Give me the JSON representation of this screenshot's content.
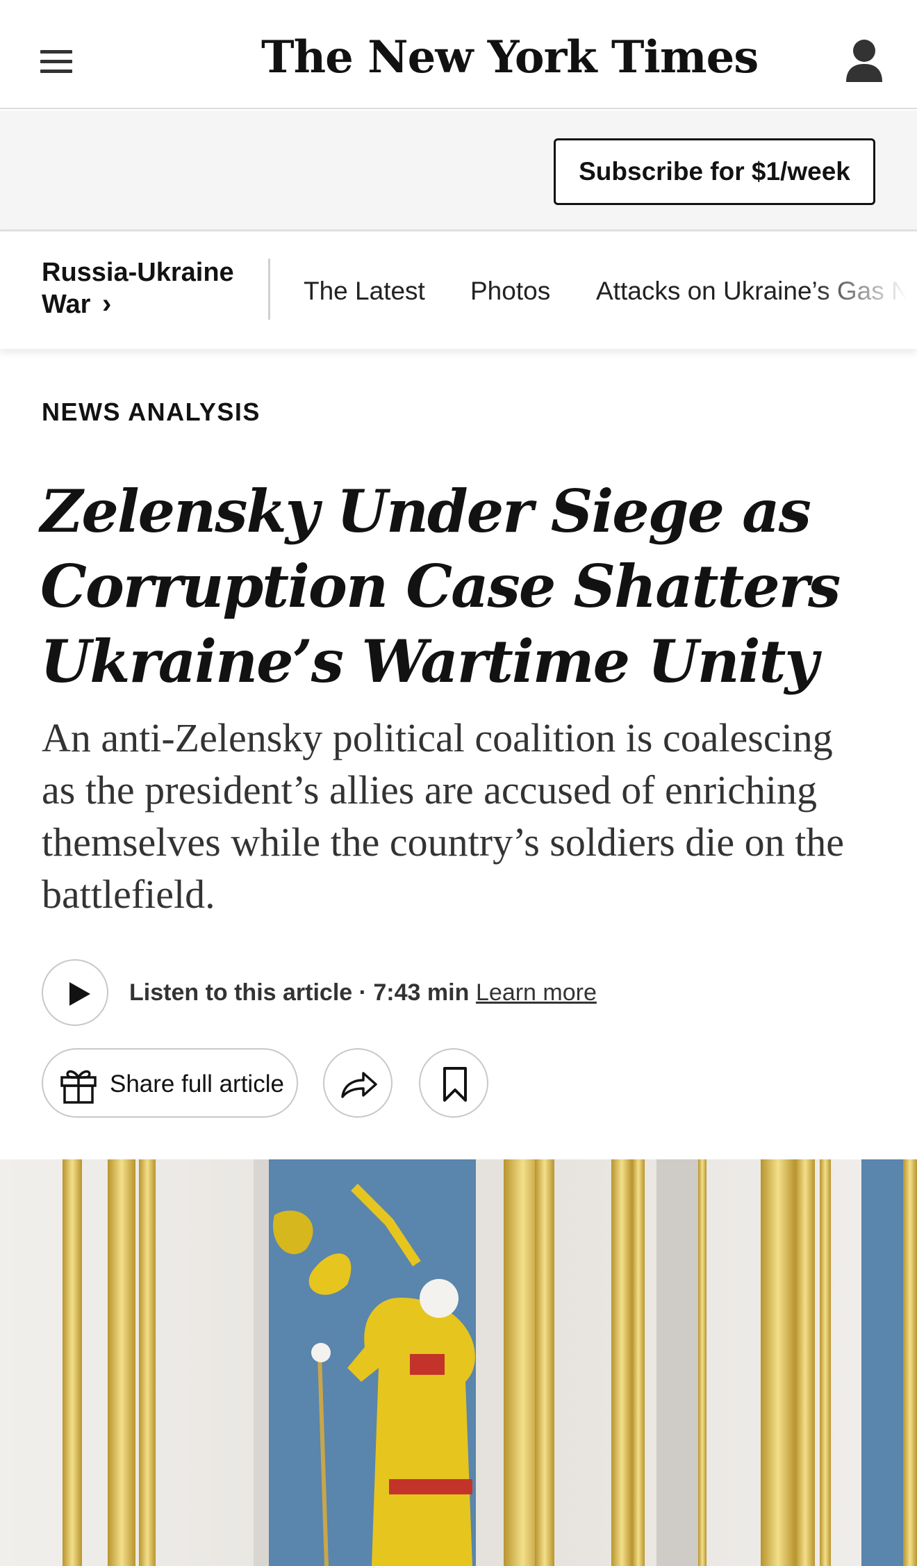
{
  "masthead": {
    "logo_text": "The New York Times",
    "menu_icon": "hamburger-menu-icon",
    "account_icon": "user-account-icon"
  },
  "subscribe": {
    "label": "Subscribe for $1/week"
  },
  "section_nav": {
    "section_title_line1": "Russia-Ukraine",
    "section_title_line2": "War",
    "chevron": "›",
    "links": [
      "The Latest",
      "Photos",
      "Attacks on Ukraine’s Gas Ne"
    ]
  },
  "article": {
    "kicker": "NEWS ANALYSIS",
    "headline_lines": [
      "Zelensky Under Siege as",
      "Corruption Case Shatters",
      "Ukraine’s Wartime Unity"
    ],
    "summary_lines": [
      "An anti-Zelensky political coalition is coalescing",
      "as the president’s allies are accused of enriching",
      "themselves while the country’s soldiers die on the",
      "battlefield."
    ]
  },
  "audio": {
    "listen_label": "Listen to this article · 7:43 min",
    "learn_more": "Learn more"
  },
  "actions": {
    "share_label": "Share full article",
    "share_icon": "forward-arrow-icon",
    "save_icon": "bookmark-icon",
    "gift_icon": "gift-icon"
  },
  "colors": {
    "text": "#121212",
    "subbar_bg": "#f5f5f5",
    "border": "#c8c8c8",
    "gold": "#d8b94a",
    "wall_blue": "#5a85ac",
    "figure_yellow": "#e6c51e",
    "figure_red": "#c4332a"
  }
}
